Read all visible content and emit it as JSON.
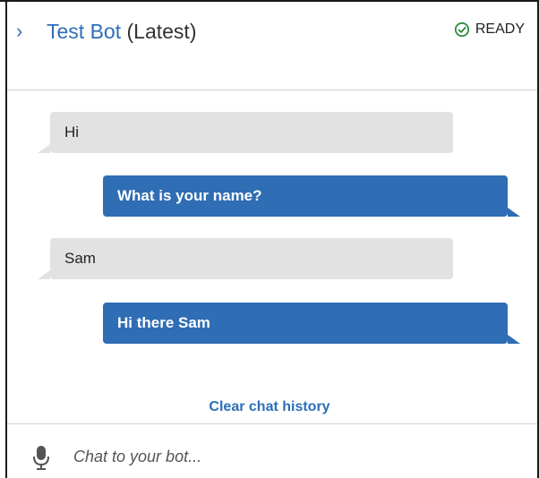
{
  "header": {
    "bot_name": "Test Bot",
    "version": "(Latest)",
    "status": "READY",
    "status_color": "#2e8b3d"
  },
  "messages": [
    {
      "from": "bot",
      "text": "Hi"
    },
    {
      "from": "user",
      "text": "What is your name?"
    },
    {
      "from": "bot",
      "text": "Sam"
    },
    {
      "from": "user",
      "text": "Hi there Sam"
    }
  ],
  "clear_label": "Clear chat history",
  "input": {
    "placeholder": "Chat to your bot...",
    "value": ""
  },
  "colors": {
    "accent": "#2c6eb8",
    "user_bubble": "#2f6db5",
    "bot_bubble": "#e2e2e2"
  }
}
